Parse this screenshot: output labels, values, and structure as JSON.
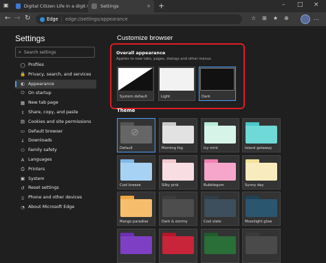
{
  "browser": {
    "tabs": [
      {
        "label": "Digital Citizen Life in a digital wo",
        "color": "#3a7bd5"
      },
      {
        "label": "Settings",
        "color": "#6a6a6a"
      }
    ],
    "new_tab_glyph": "+",
    "window_controls": [
      "–",
      "□",
      "×"
    ],
    "tab_close": "×",
    "url_brand": "Edge",
    "url_text": "edge://settings/appearance",
    "nav": {
      "back": "←",
      "forward": "→",
      "refresh": "↻"
    },
    "toolbar_icons": [
      "☆",
      "⊞",
      "★",
      "⊕",
      "…"
    ]
  },
  "sidebar": {
    "title": "Settings",
    "search_placeholder": "Search settings",
    "search_glyph": "⌕",
    "items": [
      {
        "label": "Profiles",
        "icon": "profile-icon",
        "glyph": "◯"
      },
      {
        "label": "Privacy, search, and services",
        "icon": "lock-icon",
        "glyph": "🔒"
      },
      {
        "label": "Appearance",
        "icon": "appearance-icon",
        "glyph": "◐",
        "active": true
      },
      {
        "label": "On startup",
        "icon": "power-icon",
        "glyph": "⏻"
      },
      {
        "label": "New tab page",
        "icon": "newtab-icon",
        "glyph": "▦"
      },
      {
        "label": "Share, copy, and paste",
        "icon": "share-icon",
        "glyph": "⇪"
      },
      {
        "label": "Cookies and site permissions",
        "icon": "cookie-icon",
        "glyph": "▤"
      },
      {
        "label": "Default browser",
        "icon": "browser-icon",
        "glyph": "▭"
      },
      {
        "label": "Downloads",
        "icon": "download-icon",
        "glyph": "↓"
      },
      {
        "label": "Family safety",
        "icon": "family-icon",
        "glyph": "⚇"
      },
      {
        "label": "Languages",
        "icon": "language-icon",
        "glyph": "A"
      },
      {
        "label": "Printers",
        "icon": "printer-icon",
        "glyph": "⎙"
      },
      {
        "label": "System",
        "icon": "system-icon",
        "glyph": "▣"
      },
      {
        "label": "Reset settings",
        "icon": "reset-icon",
        "glyph": "↺"
      },
      {
        "label": "Phone and other devices",
        "icon": "phone-icon",
        "glyph": "▯"
      },
      {
        "label": "About Microsoft Edge",
        "icon": "edge-icon",
        "glyph": "◔"
      }
    ]
  },
  "main": {
    "title": "Customize browser",
    "overall": {
      "title": "Overall appearance",
      "subtitle": "Applies to new tabs, pages, dialogs and other menus",
      "options": [
        {
          "label": "System default",
          "selected": false
        },
        {
          "label": "Light",
          "selected": false
        },
        {
          "label": "Dark",
          "selected": true
        }
      ]
    },
    "theme": {
      "title": "Theme",
      "cards": [
        {
          "label": "Default",
          "tab": "#555555",
          "body": "#666666",
          "selected": true
        },
        {
          "label": "Morning fog",
          "tab": "#c9c9c9",
          "body": "#e2e2e2"
        },
        {
          "label": "Icy mint",
          "tab": "#b9ecd6",
          "body": "#d6f5e8"
        },
        {
          "label": "Island getaway",
          "tab": "#49c7c6",
          "body": "#6fd9d8"
        },
        {
          "label": "Cool breeze",
          "tab": "#7fb8e8",
          "body": "#a8d2f3"
        },
        {
          "label": "Silky pink",
          "tab": "#f1c5cd",
          "body": "#f8dde2"
        },
        {
          "label": "Bubblegum",
          "tab": "#ef7fb3",
          "body": "#f6a6cb"
        },
        {
          "label": "Sunny day",
          "tab": "#f3e19a",
          "body": "#f8ecbf"
        },
        {
          "label": "Mango paradise",
          "tab": "#f2a640",
          "body": "#f6be6c"
        },
        {
          "label": "Dark & stormy",
          "tab": "#3b3b3b",
          "body": "#4d4d4d"
        },
        {
          "label": "Cool slate",
          "tab": "#2f3d49",
          "body": "#3d4e5c"
        },
        {
          "label": "Moonlight glow",
          "tab": "#1f4257",
          "body": "#2b5670"
        },
        {
          "label": "",
          "tab": "#6d2fb3",
          "body": "#7e3fc5"
        },
        {
          "label": "",
          "tab": "#b5162b",
          "body": "#c8243a"
        },
        {
          "label": "",
          "tab": "#1f5c2c",
          "body": "#2a6e38"
        },
        {
          "label": "",
          "tab": "#3b3b3b",
          "body": "#4a4a4a"
        }
      ]
    }
  }
}
